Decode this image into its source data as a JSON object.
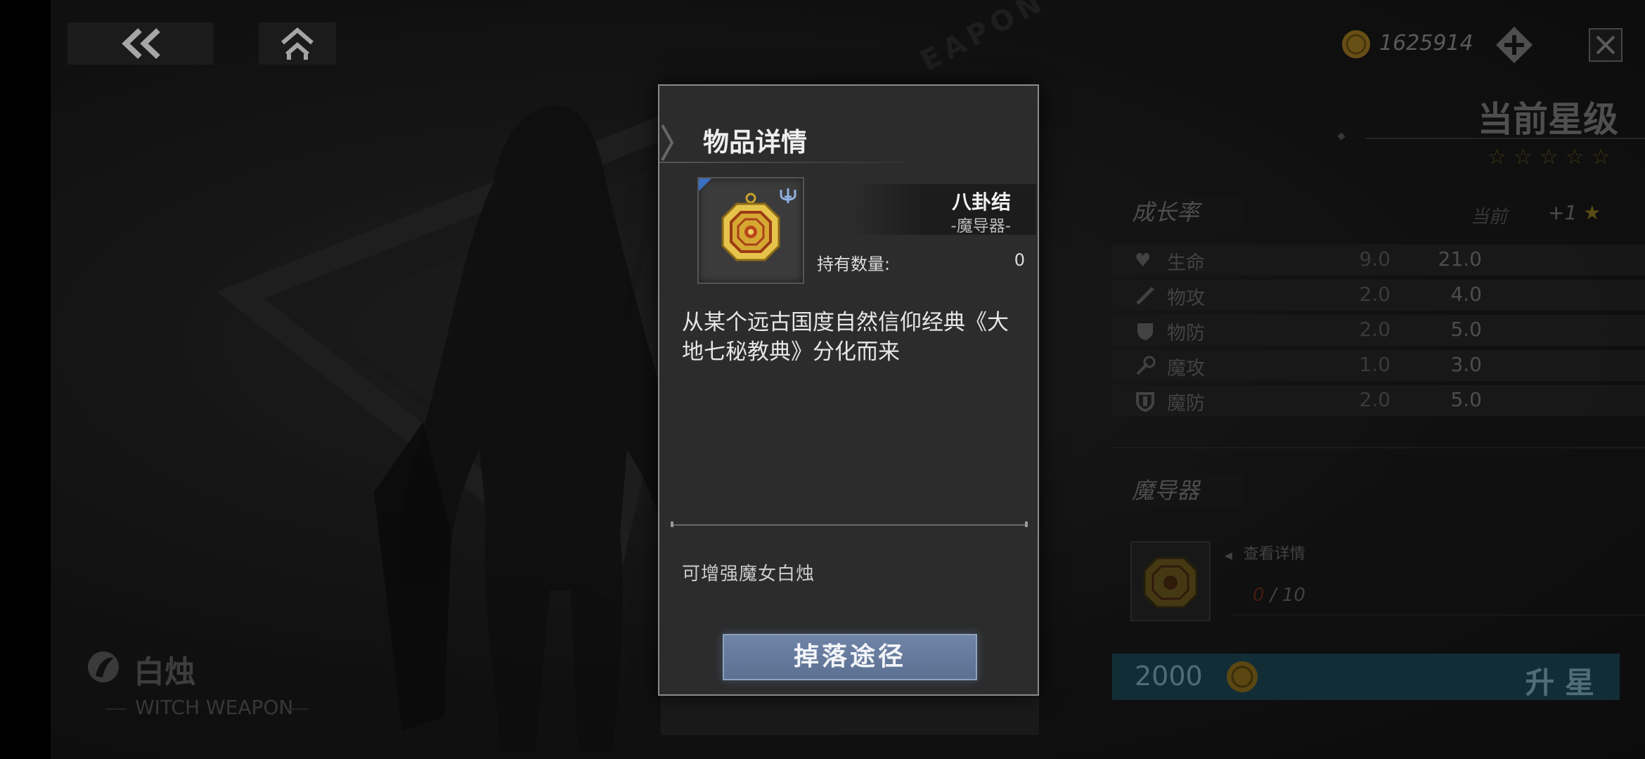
{
  "topbar": {
    "back_icon": "double-chevron-left-icon",
    "home_icon": "home-icon",
    "coin_amount": "1625914",
    "add_icon": "diamond-plus-icon",
    "close_icon": "close-icon"
  },
  "background": {
    "deco_text": "EAPON"
  },
  "character": {
    "name": "白烛",
    "subtitle": "WITCH WEAPON"
  },
  "right_panel": {
    "star_title": "当前星级",
    "stars_count": 5,
    "growth_tab": "成长率",
    "col_current": "当前",
    "col_next": "+1",
    "stats": [
      {
        "icon": "heart-icon",
        "name": "生命",
        "current": "9.0",
        "next": "21.0"
      },
      {
        "icon": "sword-icon",
        "name": "物攻",
        "current": "2.0",
        "next": "4.0"
      },
      {
        "icon": "shield-icon",
        "name": "物防",
        "current": "2.0",
        "next": "5.0"
      },
      {
        "icon": "wand-icon",
        "name": "魔攻",
        "current": "1.0",
        "next": "3.0"
      },
      {
        "icon": "magic-shield-icon",
        "name": "魔防",
        "current": "2.0",
        "next": "5.0"
      }
    ],
    "material_tab": "魔导器",
    "view_details": "查看详情",
    "owned": "0",
    "required": "/ 10",
    "upgrade_cost": "2000",
    "upgrade_label": "升 星"
  },
  "modal": {
    "title": "物品详情",
    "item_name": "八卦结",
    "item_type": "-魔导器-",
    "qty_label": "持有数量:",
    "qty_value": "0",
    "description": "从某个远古国度自然信仰经典《大地七秘教典》分化而来",
    "effect": "可增强魔女白烛",
    "drop_button": "掉落途径"
  },
  "colors": {
    "accent_blue": "#5c7092",
    "upgrade_bar": "#29a3c4",
    "gold": "#d4a52a"
  }
}
